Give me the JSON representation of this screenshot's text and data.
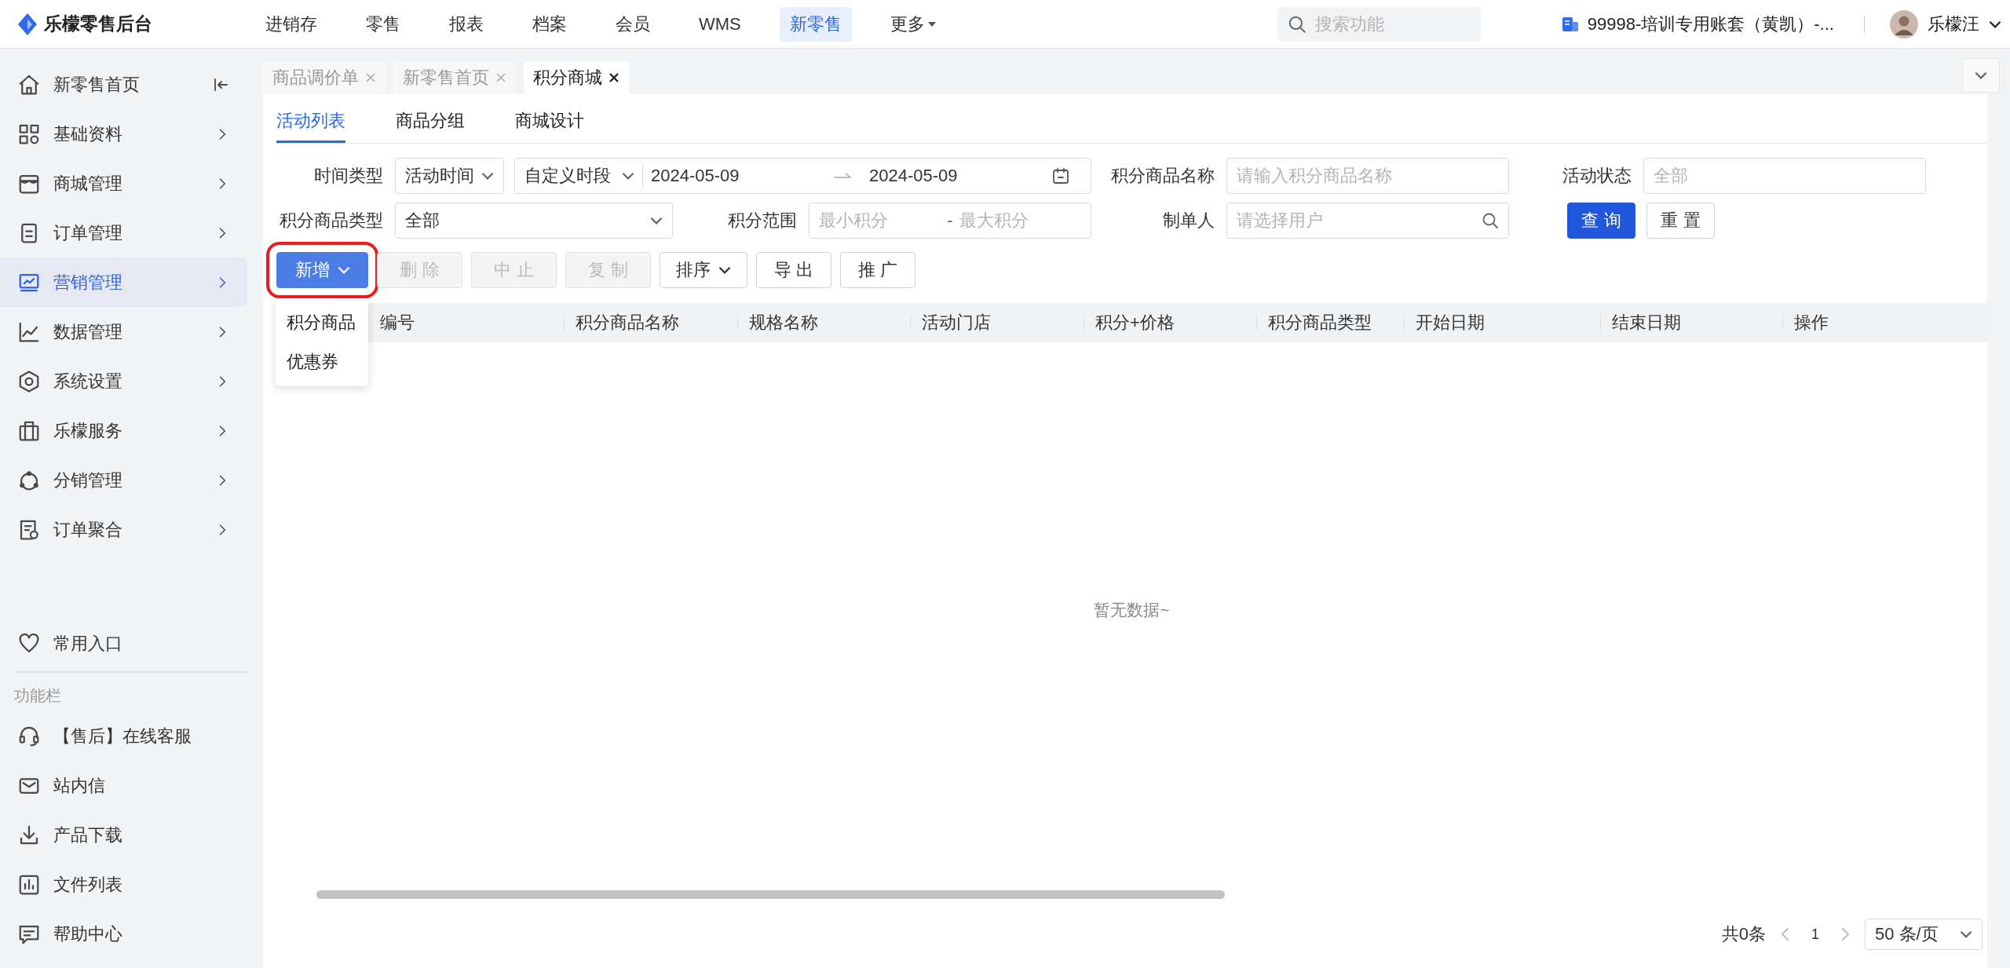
{
  "app": {
    "title": "乐檬零售后台"
  },
  "top_nav": [
    {
      "label": "进销存",
      "selected": false,
      "caret": false
    },
    {
      "label": "零售",
      "selected": false,
      "caret": false
    },
    {
      "label": "报表",
      "selected": false,
      "caret": false
    },
    {
      "label": "档案",
      "selected": false,
      "caret": false
    },
    {
      "label": "会员",
      "selected": false,
      "caret": false
    },
    {
      "label": "WMS",
      "selected": false,
      "caret": false
    },
    {
      "label": "新零售",
      "selected": true,
      "caret": false
    },
    {
      "label": "更多",
      "selected": false,
      "caret": true
    }
  ],
  "search": {
    "placeholder": "搜索功能"
  },
  "account": {
    "label": "99998-培训专用账套（黄凯）-..."
  },
  "user": {
    "name": "乐檬汪"
  },
  "sidebar": {
    "items": [
      {
        "label": "新零售首页",
        "kind": "home",
        "selected": false
      },
      {
        "label": "基础资料",
        "kind": "menu",
        "selected": false
      },
      {
        "label": "商城管理",
        "kind": "menu",
        "selected": false
      },
      {
        "label": "订单管理",
        "kind": "menu",
        "selected": false
      },
      {
        "label": "营销管理",
        "kind": "menu",
        "selected": true
      },
      {
        "label": "数据管理",
        "kind": "menu",
        "selected": false
      },
      {
        "label": "系统设置",
        "kind": "menu",
        "selected": false
      },
      {
        "label": "乐檬服务",
        "kind": "menu",
        "selected": false
      },
      {
        "label": "分销管理",
        "kind": "menu",
        "selected": false
      },
      {
        "label": "订单聚合",
        "kind": "menu",
        "selected": false
      }
    ],
    "favorites": {
      "label": "常用入口"
    },
    "function_section": {
      "title": "功能栏",
      "items": [
        "【售后】在线客服",
        "站内信",
        "产品下载",
        "文件列表",
        "帮助中心"
      ]
    }
  },
  "page_tabs": [
    {
      "label": "商品调价单",
      "selected": false
    },
    {
      "label": "新零售首页",
      "selected": false
    },
    {
      "label": "积分商城",
      "selected": true
    }
  ],
  "sub_tabs": [
    {
      "label": "活动列表",
      "selected": true
    },
    {
      "label": "商品分组",
      "selected": false
    },
    {
      "label": "商城设计",
      "selected": false
    }
  ],
  "filters": [
    {
      "label": "时间类型",
      "kind": "timerange",
      "type_value": "活动时间",
      "mode_value": "自定义时段",
      "start": "2024-05-09",
      "end": "2024-05-09"
    },
    {
      "label": "积分商品名称",
      "kind": "input",
      "placeholder": "请输入积分商品名称"
    },
    {
      "label": "活动状态",
      "kind": "input",
      "placeholder": "全部"
    },
    {
      "label": "积分商品类型",
      "kind": "select",
      "value": "全部"
    },
    {
      "label": "积分范围",
      "kind": "numrange",
      "min_placeholder": "最小积分",
      "separator": "-",
      "max_placeholder": "最大积分"
    },
    {
      "label": "制单人",
      "kind": "search",
      "placeholder": "请选择用户"
    }
  ],
  "filter_buttons": [
    {
      "label": "查 询",
      "kind": "primary"
    },
    {
      "label": "重 置",
      "kind": "default"
    }
  ],
  "actions": [
    {
      "label": "新增",
      "kind": "primary",
      "disabled": false,
      "caret": true,
      "highlighted": true
    },
    {
      "label": "删 除",
      "kind": "default",
      "disabled": true,
      "caret": false,
      "highlighted": false
    },
    {
      "label": "中 止",
      "kind": "default",
      "disabled": true,
      "caret": false,
      "highlighted": false
    },
    {
      "label": "复 制",
      "kind": "default",
      "disabled": true,
      "caret": false,
      "highlighted": false
    },
    {
      "label": "排序",
      "kind": "default",
      "disabled": false,
      "caret": true,
      "highlighted": false
    },
    {
      "label": "导 出",
      "kind": "default",
      "disabled": false,
      "caret": false,
      "highlighted": false
    },
    {
      "label": "推 广",
      "kind": "default",
      "disabled": false,
      "caret": false,
      "highlighted": false
    }
  ],
  "add_menu": {
    "items": [
      "积分商品",
      "优惠券"
    ]
  },
  "table": {
    "columns": [
      "编号",
      "积分商品名称",
      "规格名称",
      "活动门店",
      "积分+价格",
      "积分商品类型",
      "开始日期",
      "结束日期",
      "操作"
    ],
    "empty_text": "暂无数据~"
  },
  "pagination": {
    "total": "共0条",
    "prev_disabled": true,
    "page": "1",
    "next_disabled": true,
    "page_size": "50 条/页"
  }
}
